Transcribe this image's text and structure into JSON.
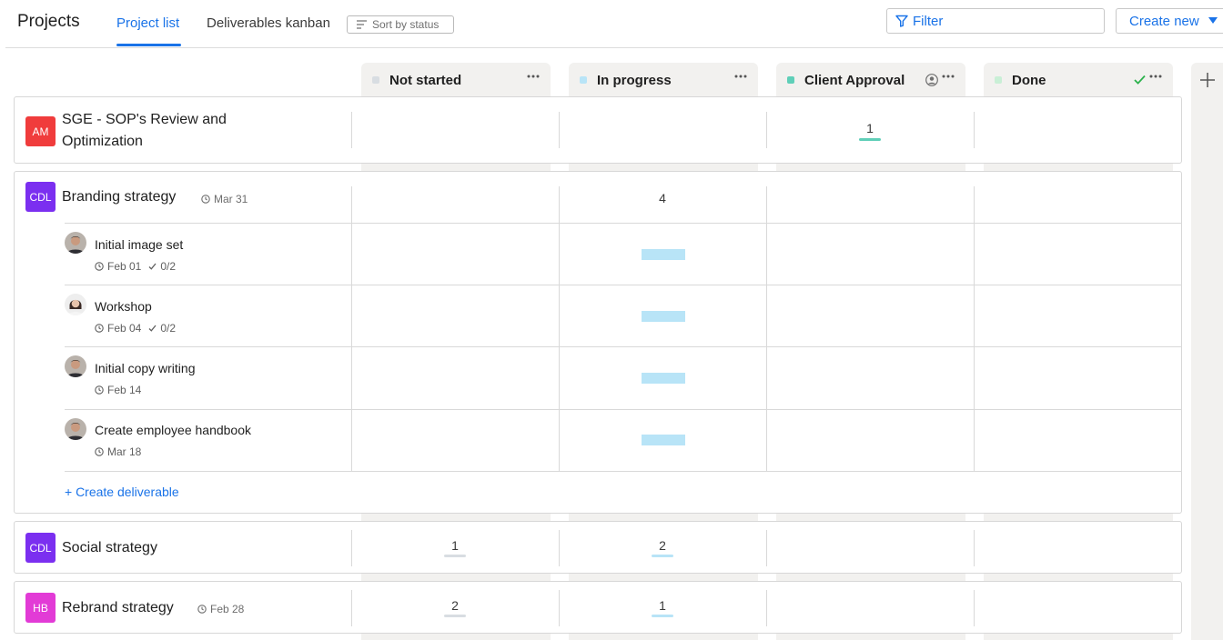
{
  "header": {
    "title": "Projects",
    "tabs": [
      {
        "label": "Project list",
        "active": true
      },
      {
        "label": "Deliverables kanban",
        "active": false
      }
    ],
    "sort_label": "Sort by status",
    "filter_label": "Filter",
    "create_label": "Create new"
  },
  "columns": [
    {
      "label": "Not started",
      "color": "#d8dde2"
    },
    {
      "label": "In progress",
      "color": "#b8e4f7"
    },
    {
      "label": "Client Approval",
      "color": "#5fcfb8"
    },
    {
      "label": "Done",
      "color": "#c9efd6"
    }
  ],
  "accent": "#1a73e8",
  "projects": [
    {
      "initials": "AM",
      "color": "#f03c3c",
      "name_line1": "SGE - SOP's Review and",
      "name_line2": "Optimization",
      "counts": {
        "client_approval": "1"
      }
    },
    {
      "initials": "CDL",
      "color": "#7b2ff0",
      "name": "Branding strategy",
      "due": "Mar 31",
      "counts": {
        "in_progress": "4"
      },
      "deliverables": [
        {
          "name": "Initial image set",
          "due": "Feb 01",
          "checks": "0/2",
          "status": "in_progress",
          "avatar": "man-avatar"
        },
        {
          "name": "Workshop",
          "due": "Feb 04",
          "checks": "0/2",
          "status": "in_progress",
          "avatar": "woman-avatar"
        },
        {
          "name": "Initial copy writing",
          "due": "Feb 14",
          "status": "in_progress",
          "avatar": "man-avatar"
        },
        {
          "name": "Create employee handbook",
          "due": "Mar 18",
          "status": "in_progress",
          "avatar": "man-avatar"
        }
      ],
      "create_deliverable_label": "+ Create deliverable"
    },
    {
      "initials": "CDL",
      "color": "#7b2ff0",
      "name": "Social strategy",
      "counts": {
        "not_started": "1",
        "in_progress": "2"
      }
    },
    {
      "initials": "HB",
      "color": "#e23bd6",
      "name": "Rebrand strategy",
      "due": "Feb 28",
      "counts": {
        "not_started": "2",
        "in_progress": "1"
      }
    }
  ]
}
